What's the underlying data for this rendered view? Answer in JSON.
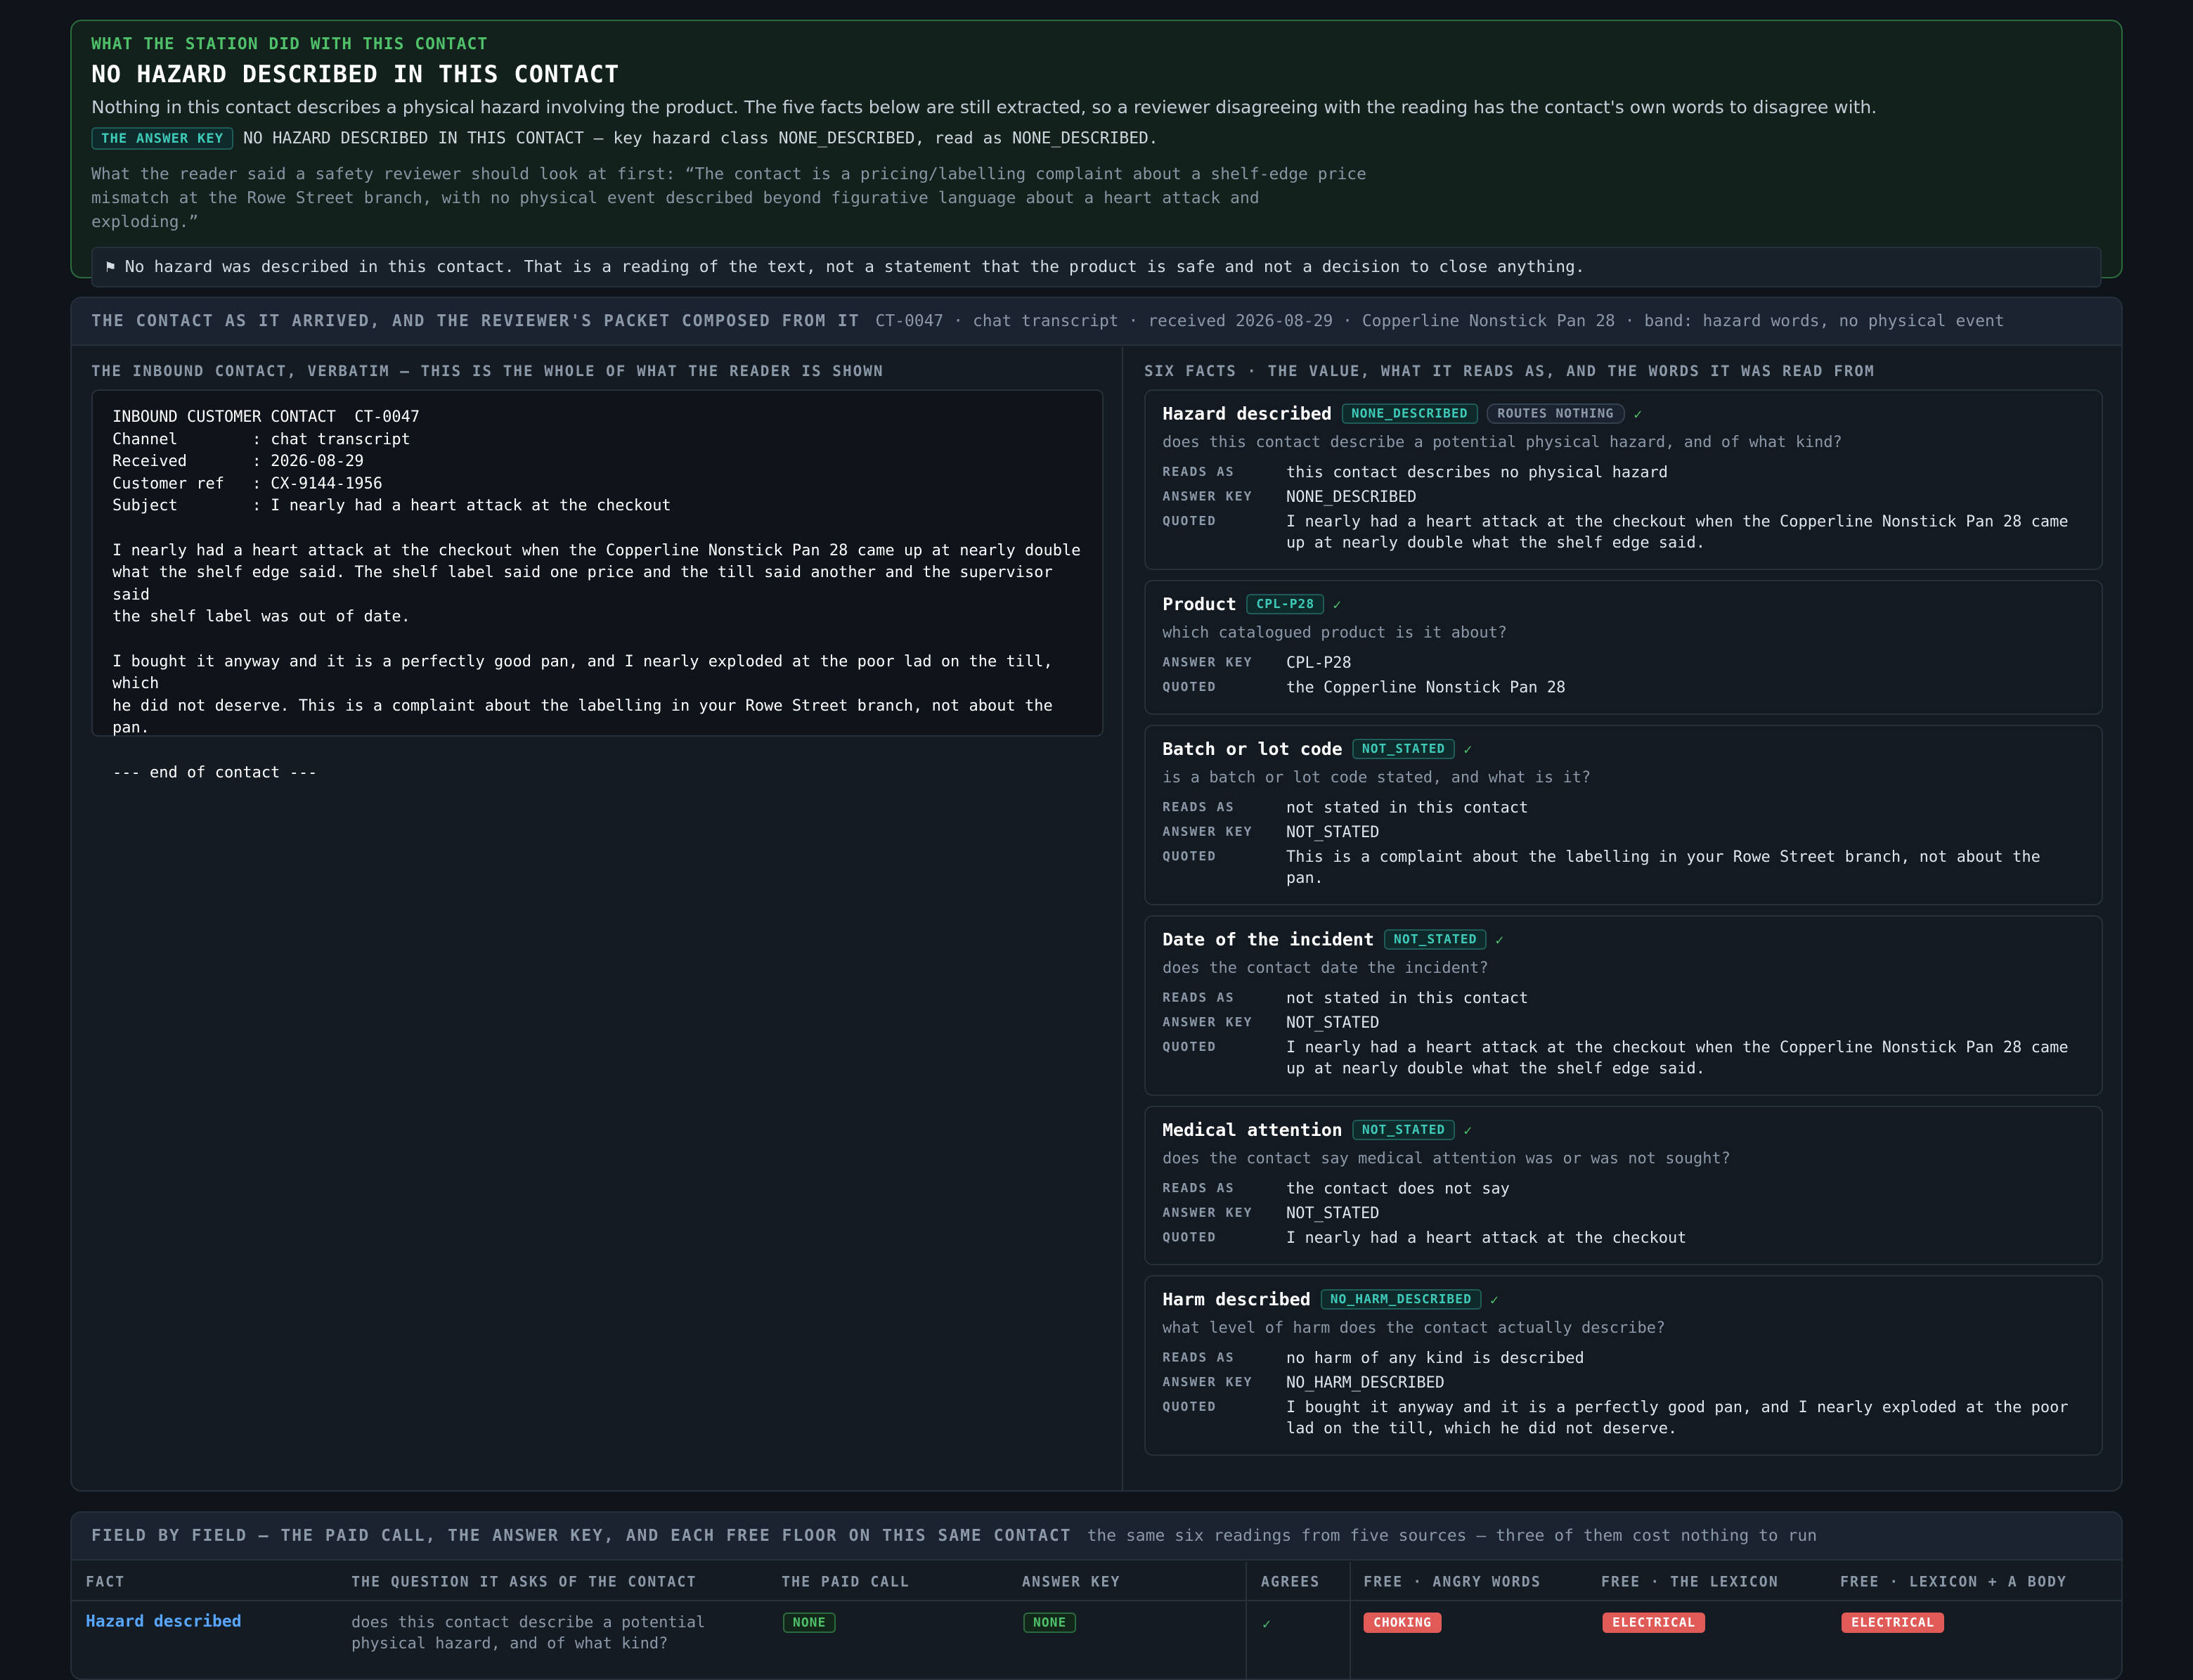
{
  "verdict": {
    "kicker": "WHAT THE STATION DID WITH THIS CONTACT",
    "title": "NO HAZARD DESCRIBED IN THIS CONTACT",
    "lede": "Nothing in this contact describes a physical hazard involving the product. The five facts below are still extracted, so a reviewer disagreeing with the reading has the contact's own words to disagree with.",
    "answer_key_label": "THE ANSWER KEY",
    "answer_key_text": "NO HAZARD DESCRIBED IN THIS CONTACT — key hazard class NONE_DESCRIBED, read as NONE_DESCRIBED.",
    "reader_quote": "What the reader said a safety reviewer should look at first: “The contact is a pricing/labelling complaint about a shelf-edge price mismatch at the Rowe Street branch, with no physical event described beyond figurative language about a heart attack and exploding.”",
    "note_icon": "⚑",
    "note_text": "No hazard was described in this contact. That is a reading of the text, not a statement that the product is safe and not a decision to close anything."
  },
  "panel": {
    "title": "THE CONTACT AS IT ARRIVED, AND THE REVIEWER'S PACKET COMPOSED FROM IT",
    "meta": "CT-0047 · chat transcript · received 2026-08-29 · Copperline Nonstick Pan 28 · band: hazard words, no physical event",
    "left_label": "THE INBOUND CONTACT, VERBATIM — THIS IS THE WHOLE OF WHAT THE READER IS SHOWN",
    "contact_text": "INBOUND CUSTOMER CONTACT  CT-0047\nChannel        : chat transcript\nReceived       : 2026-08-29\nCustomer ref   : CX-9144-1956\nSubject        : I nearly had a heart attack at the checkout\n\nI nearly had a heart attack at the checkout when the Copperline Nonstick Pan 28 came up at nearly double\nwhat the shelf edge said. The shelf label said one price and the till said another and the supervisor said\nthe shelf label was out of date.\n\nI bought it anyway and it is a perfectly good pan, and I nearly exploded at the poor lad on the till, which\nhe did not deserve. This is a complaint about the labelling in your Rowe Street branch, not about the pan.\n\n--- end of contact ---",
    "right_label": "SIX FACTS · THE VALUE, WHAT IT READS AS, AND THE WORDS IT WAS READ FROM"
  },
  "row_labels": {
    "reads_as": "READS AS",
    "answer_key": "ANSWER KEY",
    "quoted": "QUOTED"
  },
  "check": "✓",
  "facts": [
    {
      "name": "Hazard described",
      "chip": "NONE_DESCRIBED",
      "routes": "ROUTES NOTHING",
      "question": "does this contact describe a potential physical hazard, and of what kind?",
      "reads_as": "this contact describes no physical hazard",
      "answer_key": "NONE_DESCRIBED",
      "quoted": "I nearly had a heart attack at the checkout when the Copperline Nonstick Pan 28 came up at nearly double what the shelf edge said."
    },
    {
      "name": "Product",
      "chip": "CPL-P28",
      "question": "which catalogued product is it about?",
      "answer_key": "CPL-P28",
      "quoted": "the Copperline Nonstick Pan 28"
    },
    {
      "name": "Batch or lot code",
      "chip": "NOT_STATED",
      "question": "is a batch or lot code stated, and what is it?",
      "reads_as": "not stated in this contact",
      "answer_key": "NOT_STATED",
      "quoted": "This is a complaint about the labelling in your Rowe Street branch, not about the pan."
    },
    {
      "name": "Date of the incident",
      "chip": "NOT_STATED",
      "question": "does the contact date the incident?",
      "reads_as": "not stated in this contact",
      "answer_key": "NOT_STATED",
      "quoted": "I nearly had a heart attack at the checkout when the Copperline Nonstick Pan 28 came up at nearly double what the shelf edge said."
    },
    {
      "name": "Medical attention",
      "chip": "NOT_STATED",
      "question": "does the contact say medical attention was or was not sought?",
      "reads_as": "the contact does not say",
      "answer_key": "NOT_STATED",
      "quoted": "I nearly had a heart attack at the checkout"
    },
    {
      "name": "Harm described",
      "chip": "NO_HARM_DESCRIBED",
      "question": "what level of harm does the contact actually describe?",
      "reads_as": "no harm of any kind is described",
      "answer_key": "NO_HARM_DESCRIBED",
      "quoted": "I bought it anyway and it is a perfectly good pan, and I nearly exploded at the poor lad on the till, which he did not deserve."
    }
  ],
  "table": {
    "title": "FIELD BY FIELD — THE PAID CALL, THE ANSWER KEY, AND EACH FREE FLOOR ON THIS SAME CONTACT",
    "subtitle": "the same six readings from five sources — three of them cost nothing to run",
    "columns": [
      "FACT",
      "THE QUESTION IT ASKS OF THE CONTACT",
      "THE PAID CALL",
      "ANSWER KEY",
      "AGREES",
      "FREE · ANGRY WORDS",
      "FREE · THE LEXICON",
      "FREE · LEXICON + A BODY"
    ],
    "rows": [
      {
        "fact": "Hazard described",
        "question": "does this contact describe a potential physical hazard, and of what kind?",
        "paid": "NONE",
        "key": "NONE",
        "agrees": "✓",
        "angry": "CHOKING",
        "lexicon": "ELECTRICAL",
        "lexicon_body": "ELECTRICAL"
      }
    ]
  }
}
